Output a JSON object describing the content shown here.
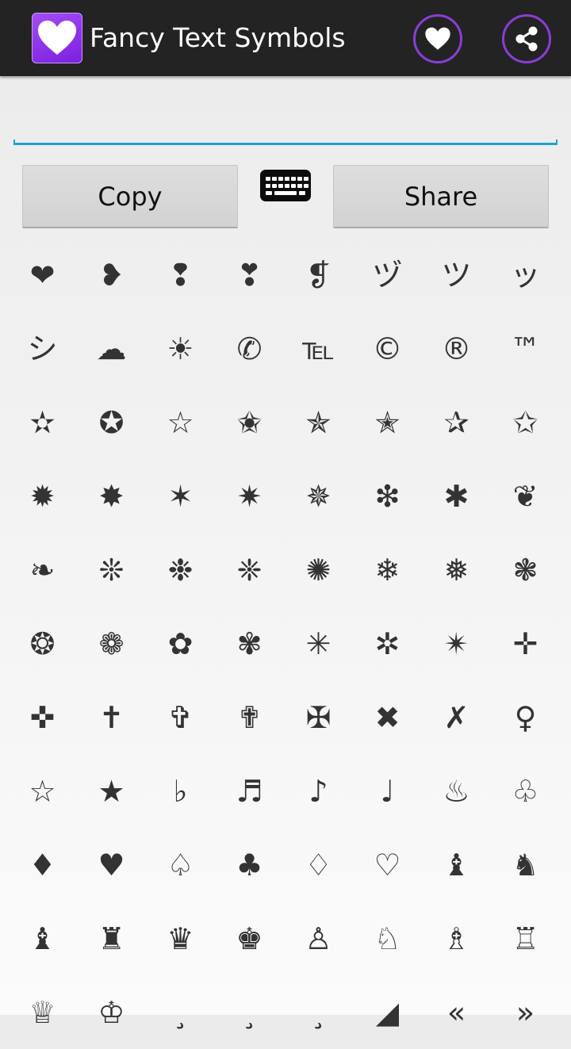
{
  "appbar": {
    "title": "Fancy Text Symbols",
    "icons": [
      "heart-icon",
      "favorite-heart-icon",
      "share-icon"
    ],
    "accent_color": "#8b3dd6",
    "bar_color": "#232323"
  },
  "editor": {
    "value": "",
    "placeholder": "",
    "underline_color": "#1ba1d8"
  },
  "actions": {
    "copy_label": "Copy",
    "share_label": "Share",
    "keyboard_icon": "keyboard-icon"
  },
  "symbols": [
    [
      "❤",
      "❥",
      "❢",
      "❣",
      "❡",
      "ヅ",
      "ツ",
      "ッ"
    ],
    [
      "シ",
      "☁",
      "☀",
      "✆",
      "℡",
      "©",
      "®",
      "™"
    ],
    [
      "✫",
      "✪",
      "☆",
      "✬",
      "✯",
      "✭",
      "✰",
      "✩"
    ],
    [
      "✹",
      "✸",
      "✶",
      "✷",
      "✵",
      "❇",
      "✱",
      "❦"
    ],
    [
      "❧",
      "❊",
      "❉",
      "❈",
      "✺",
      "❄",
      "❅",
      "❃"
    ],
    [
      "❂",
      "❁",
      "✿",
      "✾",
      "✳",
      "✲",
      "✴",
      "✛"
    ],
    [
      "✜",
      "✝",
      "✞",
      "✟",
      "✠",
      "✖",
      "✗",
      "♀"
    ],
    [
      "☆",
      "★",
      "♭",
      "♬",
      "♪",
      "♩",
      "♨",
      "♧"
    ],
    [
      "♦",
      "♥",
      "♤",
      "♣",
      "♢",
      "♡",
      "♝",
      "♞"
    ],
    [
      "♝",
      "♜",
      "♛",
      "♚",
      "♙",
      "♘",
      "♗",
      "♖"
    ],
    [
      "♕",
      "♔",
      "¸",
      "¸",
      "¸",
      "◢",
      "«",
      "»"
    ]
  ]
}
